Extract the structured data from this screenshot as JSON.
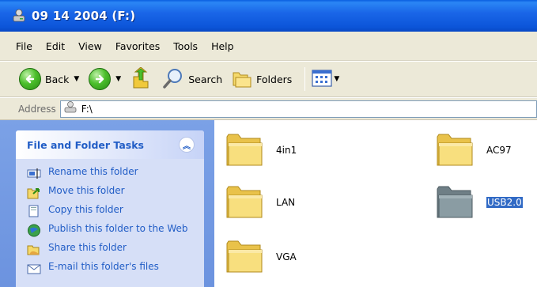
{
  "window": {
    "title": "09 14 2004 (F:)"
  },
  "menu": [
    "File",
    "Edit",
    "View",
    "Favorites",
    "Tools",
    "Help"
  ],
  "toolbar": {
    "back_label": "Back",
    "search_label": "Search",
    "folders_label": "Folders"
  },
  "address": {
    "label": "Address",
    "value": "F:\\"
  },
  "taskpane": {
    "title": "File and Folder Tasks",
    "items": [
      {
        "label": "Rename this folder",
        "icon": "rename-icon"
      },
      {
        "label": "Move this folder",
        "icon": "move-icon"
      },
      {
        "label": "Copy this folder",
        "icon": "copy-icon"
      },
      {
        "label": "Publish this folder to the Web",
        "icon": "publish-icon"
      },
      {
        "label": "Share this folder",
        "icon": "share-icon"
      },
      {
        "label": "E-mail this folder's files",
        "icon": "email-icon"
      }
    ]
  },
  "folders": [
    {
      "name": "4in1",
      "selected": false
    },
    {
      "name": "AC97",
      "selected": false
    },
    {
      "name": "LAN",
      "selected": false
    },
    {
      "name": "USB2.0",
      "selected": true
    },
    {
      "name": "VGA",
      "selected": false
    }
  ],
  "colors": {
    "title_bar": "#0c55d9",
    "task_pane": "#6c93df",
    "link": "#215dc6",
    "selection": "#316ac5",
    "folder": "#f5d96b"
  }
}
